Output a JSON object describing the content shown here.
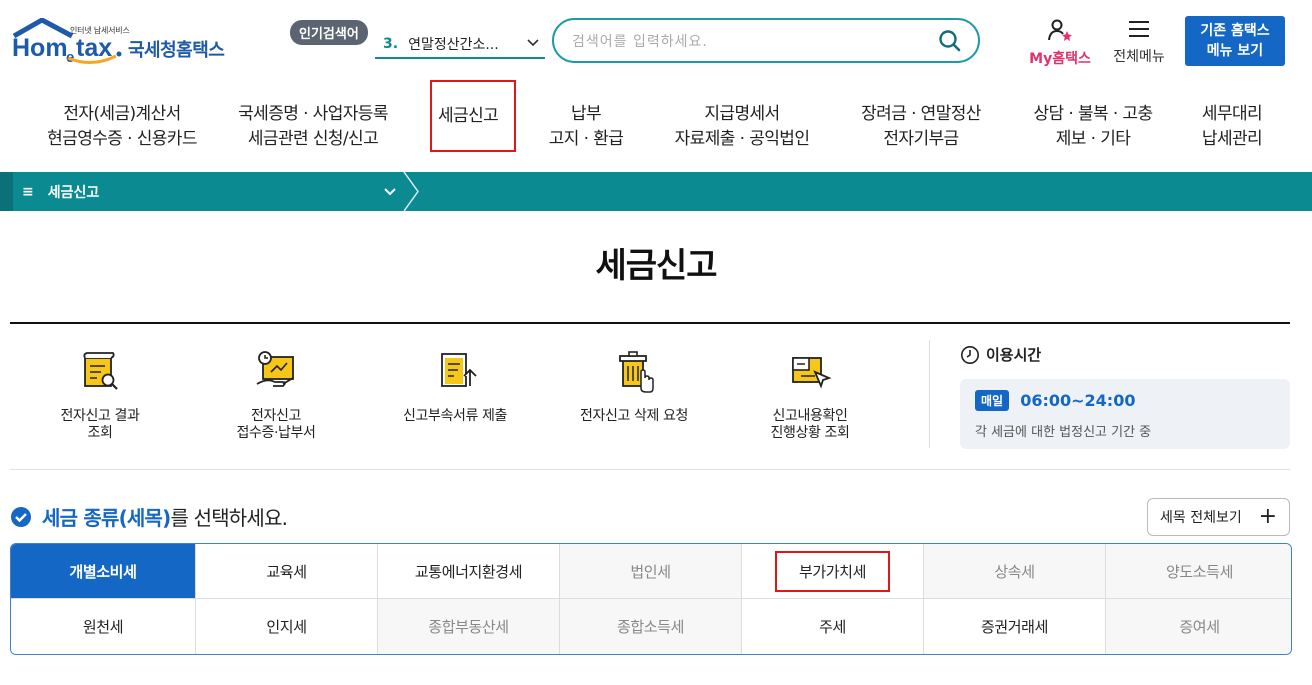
{
  "header": {
    "logo_tagline": "인터넷 납세서비스",
    "logo_word": "Hometax.",
    "logo_brand": "국세청홈택스",
    "popular_badge": "인기검색어",
    "popular_rank": "3.",
    "popular_keyword": "연말정산간소...",
    "search_placeholder": "검색어를 입력하세요.",
    "my_hometax": "My홈택스",
    "all_menu": "전체메뉴",
    "legacy_line1": "기존 홈택스",
    "legacy_line2": "메뉴 보기"
  },
  "nav": [
    {
      "line1": "전자(세금)계산서",
      "line2": "현금영수증 · 신용카드"
    },
    {
      "line1": "국세증명 · 사업자등록",
      "line2": "세금관련 신청/신고"
    },
    {
      "line1": "세금신고",
      "line2": ""
    },
    {
      "line1": "납부",
      "line2": "고지 · 환급"
    },
    {
      "line1": "지급명세서",
      "line2": "자료제출 · 공익법인"
    },
    {
      "line1": "장려금 · 연말정산",
      "line2": "전자기부금"
    },
    {
      "line1": "상담 · 불복 · 고충",
      "line2": "제보 · 기타"
    },
    {
      "line1": "세무대리",
      "line2": "납세관리"
    }
  ],
  "breadcrumb": {
    "current": "세금신고"
  },
  "page_title": "세금신고",
  "quick_menu": [
    {
      "line1": "전자신고 결과",
      "line2": "조회",
      "icon": "document-search-icon"
    },
    {
      "line1": "전자신고",
      "line2": "접수증·납부서",
      "icon": "receipt-payment-icon"
    },
    {
      "line1": "신고부속서류 제출",
      "line2": "",
      "icon": "document-upload-icon"
    },
    {
      "line1": "전자신고 삭제 요청",
      "line2": "",
      "icon": "trash-delete-icon"
    },
    {
      "line1": "신고내용확인",
      "line2": "진행상황 조회",
      "icon": "document-check-icon"
    }
  ],
  "hours": {
    "title": "이용시간",
    "badge": "매일",
    "time": "06:00~24:00",
    "note": "각 세금에 대한 법정신고 기간 중"
  },
  "tax_select": {
    "heading_blue": "세금 종류(세목)",
    "heading_rest": "를 선택하세요.",
    "view_all": "세목 전체보기",
    "items": [
      {
        "label": "개별소비세",
        "state": "selected"
      },
      {
        "label": "교육세",
        "state": "normal"
      },
      {
        "label": "교통에너지환경세",
        "state": "normal"
      },
      {
        "label": "법인세",
        "state": "dim"
      },
      {
        "label": "부가가치세",
        "state": "highlight"
      },
      {
        "label": "상속세",
        "state": "dim"
      },
      {
        "label": "양도소득세",
        "state": "dim"
      },
      {
        "label": "원천세",
        "state": "normal"
      },
      {
        "label": "인지세",
        "state": "normal"
      },
      {
        "label": "종합부동산세",
        "state": "dim"
      },
      {
        "label": "종합소득세",
        "state": "dim"
      },
      {
        "label": "주세",
        "state": "normal"
      },
      {
        "label": "증권거래세",
        "state": "normal"
      },
      {
        "label": "증여세",
        "state": "dim"
      }
    ]
  },
  "colors": {
    "accent_teal": "#0b8a92",
    "primary_blue": "#1467c4",
    "highlight_red": "#e0161b",
    "my_pink": "#e0336c"
  }
}
